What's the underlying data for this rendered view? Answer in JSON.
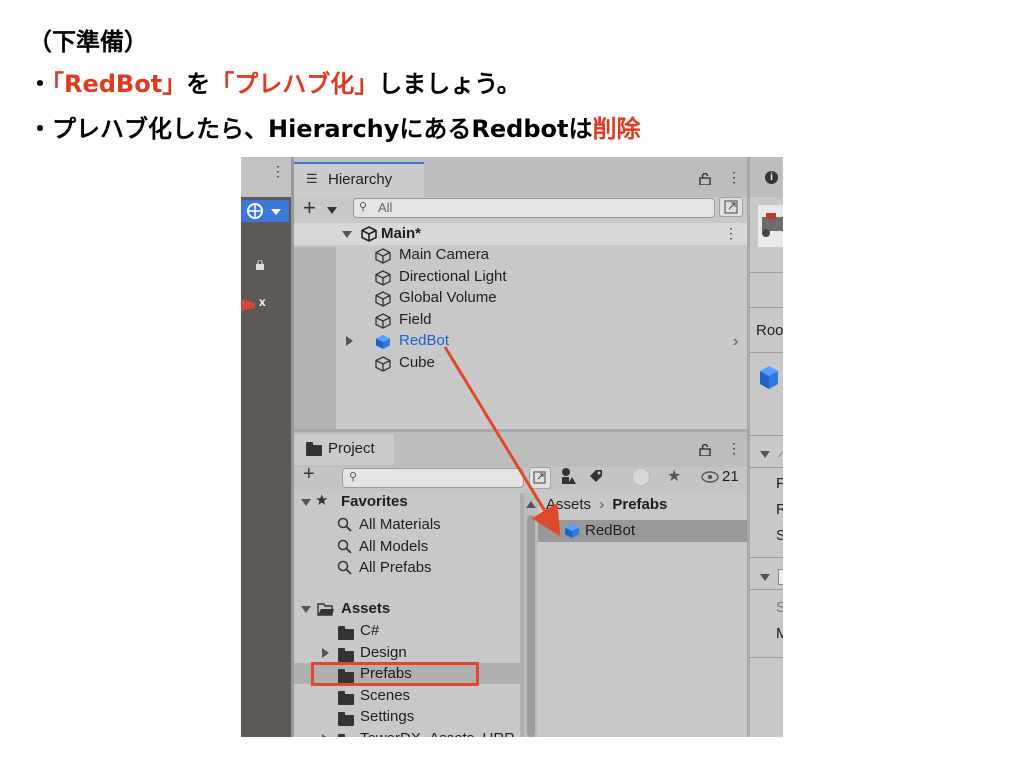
{
  "slide": {
    "line1": "（下準備）",
    "line2_prefix": "・",
    "line2_hl1": "「RedBot」",
    "line2_mid": "を",
    "line2_hl2": "「プレハブ化」",
    "line2_suffix": "しましょう。",
    "line3_prefix": "・プレハブ化したら、HierarchyにあるRedbotは",
    "line3_hl": "削除"
  },
  "colors": {
    "highlight": "#e03a1e",
    "selection": "#3a79d8",
    "arrow": "#e0482a"
  },
  "hierarchy": {
    "tab_label": "Hierarchy",
    "search_placeholder": "All",
    "scene_name": "Main*",
    "items": [
      {
        "label": "Main Camera",
        "icon": "gameobject-cube-icon"
      },
      {
        "label": "Directional Light",
        "icon": "gameobject-cube-icon"
      },
      {
        "label": "Global Volume",
        "icon": "gameobject-cube-icon"
      },
      {
        "label": "Field",
        "icon": "gameobject-cube-icon"
      },
      {
        "label": "RedBot",
        "icon": "prefab-cube-icon"
      },
      {
        "label": "Cube",
        "icon": "gameobject-cube-icon"
      }
    ]
  },
  "project": {
    "tab_label": "Project",
    "visible_count": "21",
    "favorites": {
      "label": "Favorites",
      "items": [
        "All Materials",
        "All Models",
        "All Prefabs"
      ]
    },
    "assets": {
      "label": "Assets",
      "folders": [
        "C#",
        "Design",
        "Prefabs",
        "Scenes",
        "Settings"
      ],
      "partial_folder": "TowerDX_Assets_URP"
    },
    "breadcrumb": {
      "root": "Assets",
      "current": "Prefabs"
    },
    "content_items": [
      "RedBot"
    ]
  },
  "inspector": {
    "rows": [
      "Roo",
      "P",
      "R",
      "S",
      "S",
      "M"
    ]
  },
  "scene_view": {
    "gizmo_axis": "x"
  }
}
